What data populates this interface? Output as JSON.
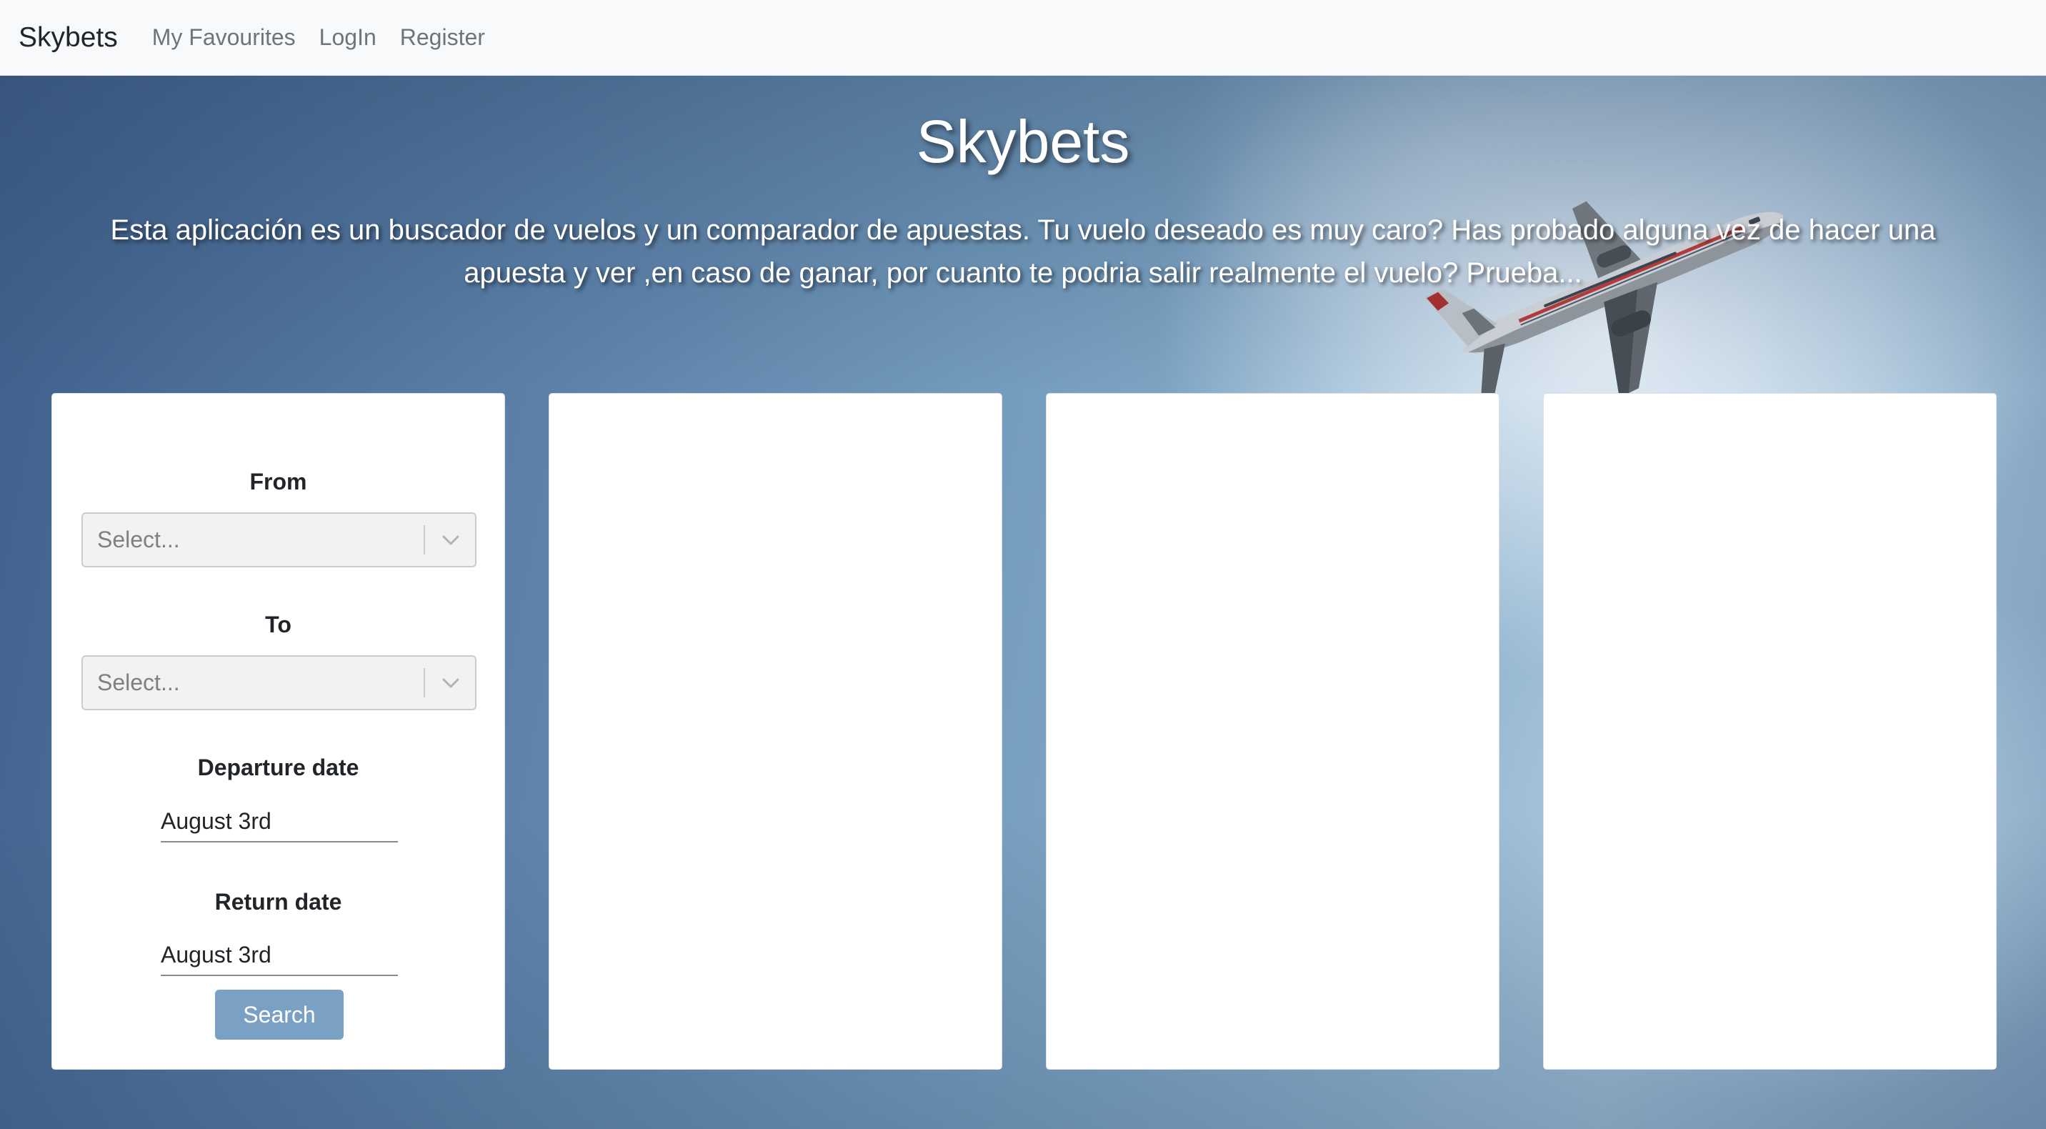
{
  "navbar": {
    "brand": "Skybets",
    "links": [
      "My Favourites",
      "LogIn",
      "Register"
    ]
  },
  "hero": {
    "title": "Skybets",
    "description": "Esta aplicación es un buscador de vuelos y un comparador de apuestas. Tu vuelo deseado es muy caro? Has probado alguna vez de hacer una apuesta y ver ,en caso de ganar, por cuanto te podria salir realmente el vuelo? Prueba..."
  },
  "search_form": {
    "from_label": "From",
    "from_placeholder": "Select...",
    "to_label": "To",
    "to_placeholder": "Select...",
    "departure_label": "Departure date",
    "departure_value": "August 3rd",
    "return_label": "Return date",
    "return_value": "August 3rd",
    "search_label": "Search"
  },
  "icons": {
    "dropdown": "chevron-down-icon",
    "background": "airplane-image"
  },
  "colors": {
    "navbar_bg": "#f8f9fa",
    "search_button": "#7aa0c4",
    "card_bg": "#ffffff"
  }
}
